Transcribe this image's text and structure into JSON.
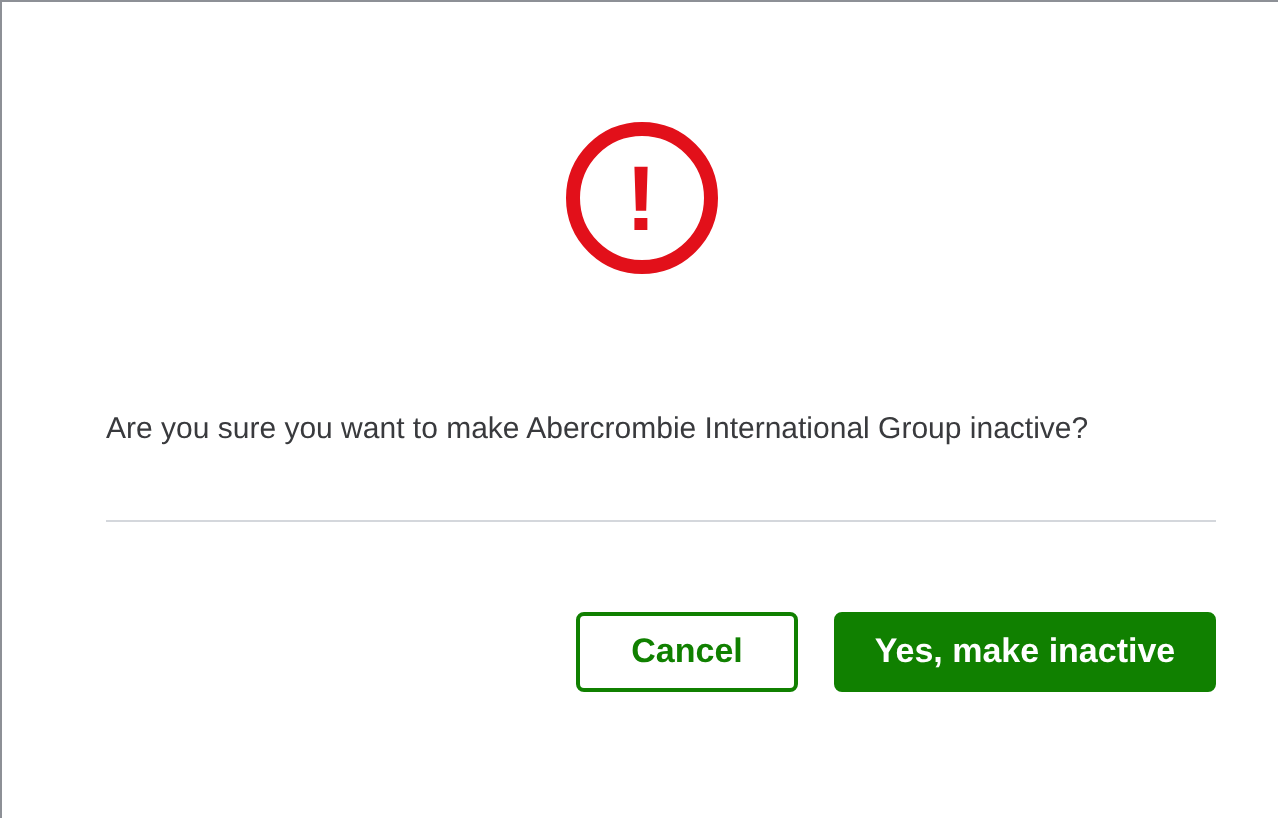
{
  "dialog": {
    "icon": "!",
    "message": "Are you sure you want to make Abercrombie International Group inactive?",
    "buttons": [
      {
        "label": "Cancel",
        "kind": "secondary"
      },
      {
        "label": "Yes, make inactive",
        "kind": "primary"
      }
    ]
  }
}
